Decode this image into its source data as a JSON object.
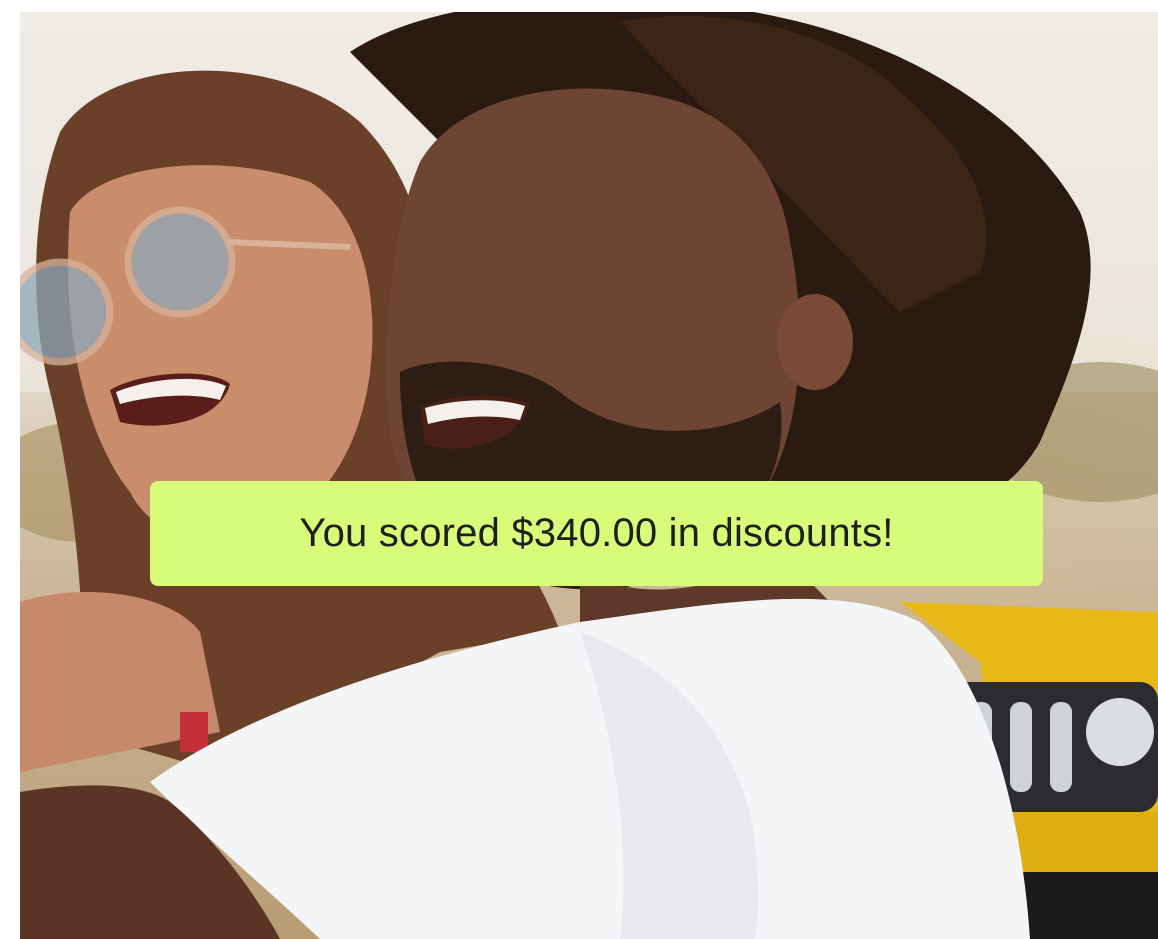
{
  "hero": {
    "image_name": "couple-photo",
    "colors": {
      "banner_bg": "#d9fb7a",
      "banner_text": "#1f1f1f",
      "shirt": "#f4f5f7",
      "skin": "#6e4432",
      "hair": "#2a1a12",
      "vehicle_yellow": "#e7b817"
    }
  },
  "banner": {
    "message": "You scored $340.00 in discounts!"
  }
}
